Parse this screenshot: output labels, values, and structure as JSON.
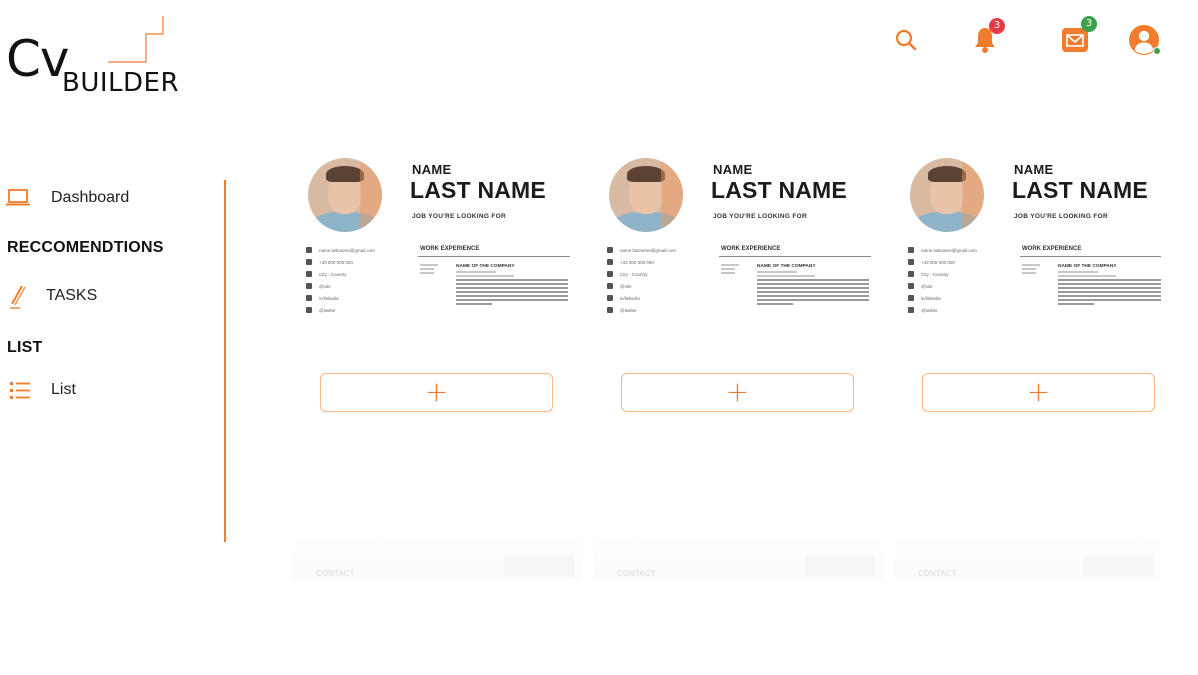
{
  "logo": {
    "cv": "Cv",
    "builder": "BUILDER"
  },
  "header": {
    "notifications": {
      "icon": "bell-icon",
      "count": "3"
    },
    "messages": {
      "icon": "envelope-icon",
      "count": "3"
    },
    "search": {
      "icon": "search-icon"
    },
    "profile": {
      "icon": "user-avatar-icon"
    },
    "accent": "#f07c2c"
  },
  "sidebar": {
    "dashboard": {
      "label": "Dashboard",
      "icon": "laptop-icon"
    },
    "section_recommendations": "RECCOMENDTIONS",
    "tasks": {
      "label": "TASKS",
      "icon": "pencil-icon"
    },
    "section_list": "LIST",
    "list": {
      "label": "List",
      "icon": "list-icon"
    }
  },
  "templates": [
    {
      "name": "NAME",
      "last_name": "LAST NAME",
      "job": "JOB YOU'RE LOOKING FOR",
      "section": "WORK EXPERIENCE",
      "company": "NAME OF THE COMPANY",
      "contacts": [
        "name.lastname@gmail.com",
        "+33 000 000 000",
        "City - Country",
        "@site",
        "in/linkedin",
        "@twitter"
      ],
      "add_label": "+"
    },
    {
      "name": "NAME",
      "last_name": "LAST NAME",
      "job": "JOB YOU'RE LOOKING FOR",
      "section": "WORK EXPERIENCE",
      "company": "NAME OF THE COMPANY",
      "contacts": [
        "name.lastname@gmail.com",
        "+33 000 000 000",
        "City - Country",
        "@site",
        "in/linkedin",
        "@twitter"
      ],
      "add_label": "+"
    },
    {
      "name": "NAME",
      "last_name": "LAST NAME",
      "job": "JOB YOU'RE LOOKING FOR",
      "section": "WORK EXPERIENCE",
      "company": "NAME OF THE COMPANY",
      "contacts": [
        "name.lastname@gmail.com",
        "+33 000 000 000",
        "City - Country",
        "@site",
        "in/linkedin",
        "@twitter"
      ],
      "add_label": "+"
    }
  ],
  "ghost_label": "CONTACT"
}
